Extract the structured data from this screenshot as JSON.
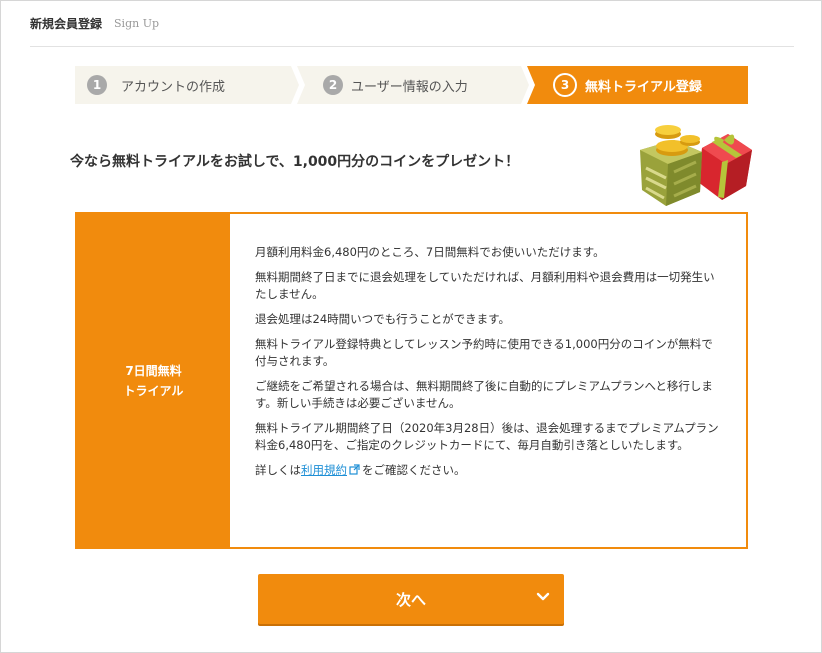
{
  "header": {
    "title": "新規会員登録",
    "subtitle": "Sign Up"
  },
  "steps": [
    {
      "number": "1",
      "label": "アカウントの作成",
      "state": "done"
    },
    {
      "number": "2",
      "label": "ユーザー情報の入力",
      "state": "done"
    },
    {
      "number": "3",
      "label": "無料トライアル登録",
      "state": "current"
    }
  ],
  "headline": "今なら無料トライアルをお試しで、1,000円分のコインをプレゼント！",
  "info": {
    "label_line1": "7日間無料",
    "label_line2": "トライアル",
    "paragraphs": [
      "月額利用料金6,480円のところ、7日間無料でお使いいただけます。",
      "無料期間終了日までに退会処理をしていただければ、月額利用料や退会費用は一切発生いたしません。",
      "退会処理は24時間いつでも行うことができます。",
      "無料トライアル登録特典としてレッスン予約時に使用できる1,000円分のコインが無料で付与されます。",
      "ご継続をご希望される場合は、無料期間終了後に自動的にプレミアムプランへと移行します。新しい手続きは必要ございません。",
      "無料トライアル期間終了日（2020年3月28日）後は、退会処理するまでプレミアムプラン料金6,480円を、ご指定のクレジットカードにて、毎月自動引き落としいたします。"
    ],
    "terms_prefix": "詳しくは",
    "terms_link": "利用規約",
    "terms_suffix": "をご確認ください。"
  },
  "next_button": {
    "label": "次へ"
  },
  "colors": {
    "accent": "#f18b0d",
    "step_inactive": "#f6f4ec",
    "link": "#1e8fd6"
  },
  "icons": {
    "gift": "gift-coins-icon",
    "external": "external-link-icon",
    "chevron": "chevron-down-icon"
  }
}
